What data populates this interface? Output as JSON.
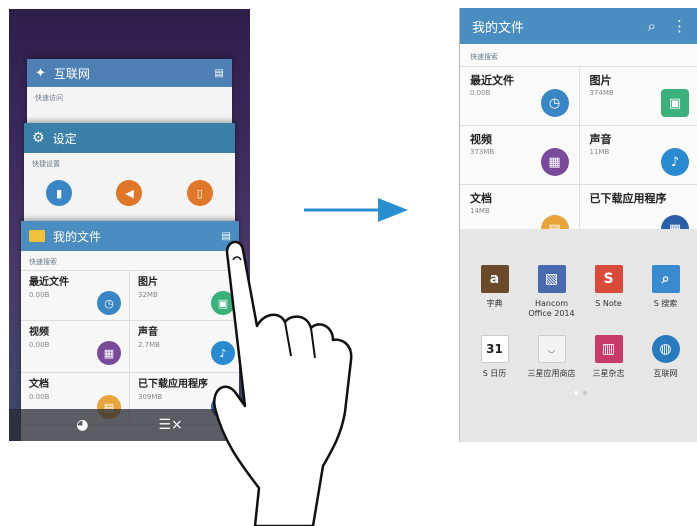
{
  "left_phone": {
    "internet_card": {
      "title": "互联网",
      "section": "快速访问"
    },
    "settings_card": {
      "title": "设定",
      "section": "快捷设置"
    },
    "files_card": {
      "title": "我的文件",
      "section": "快速搜索",
      "items": [
        {
          "name": "最近文件",
          "size": "0.00B"
        },
        {
          "name": "图片",
          "size": "32MB"
        },
        {
          "name": "视频",
          "size": "0.00B"
        },
        {
          "name": "声音",
          "size": "2.7MB"
        },
        {
          "name": "文档",
          "size": "0.00B"
        },
        {
          "name": "已下载应用程序",
          "size": "309MB"
        }
      ]
    }
  },
  "right_phone": {
    "header": {
      "title": "我的文件"
    },
    "section": "快速搜索",
    "items": [
      {
        "name": "最近文件",
        "size": "0.00B"
      },
      {
        "name": "图片",
        "size": "374MB"
      },
      {
        "name": "视频",
        "size": "373MB"
      },
      {
        "name": "声音",
        "size": "11MB"
      },
      {
        "name": "文档",
        "size": "14MB"
      },
      {
        "name": "已下载应用程序",
        "size": ""
      }
    ],
    "apps": [
      {
        "label": "字典"
      },
      {
        "label": "Hancom Office 2014"
      },
      {
        "label": "S Note"
      },
      {
        "label": "S 搜索"
      },
      {
        "label": "S 日历"
      },
      {
        "label": "三星应用商店"
      },
      {
        "label": "三星杂志"
      },
      {
        "label": "互联网"
      }
    ],
    "calendar_day": "31"
  },
  "colors": {
    "header_blue": "#4a8dc0",
    "recent_icon": "#3a86c4",
    "image_icon": "#3cb07a",
    "video_icon": "#7a4a9a",
    "audio_icon": "#2a8ad0",
    "doc_icon": "#e8a43a",
    "download_icon": "#2a5ea8"
  }
}
